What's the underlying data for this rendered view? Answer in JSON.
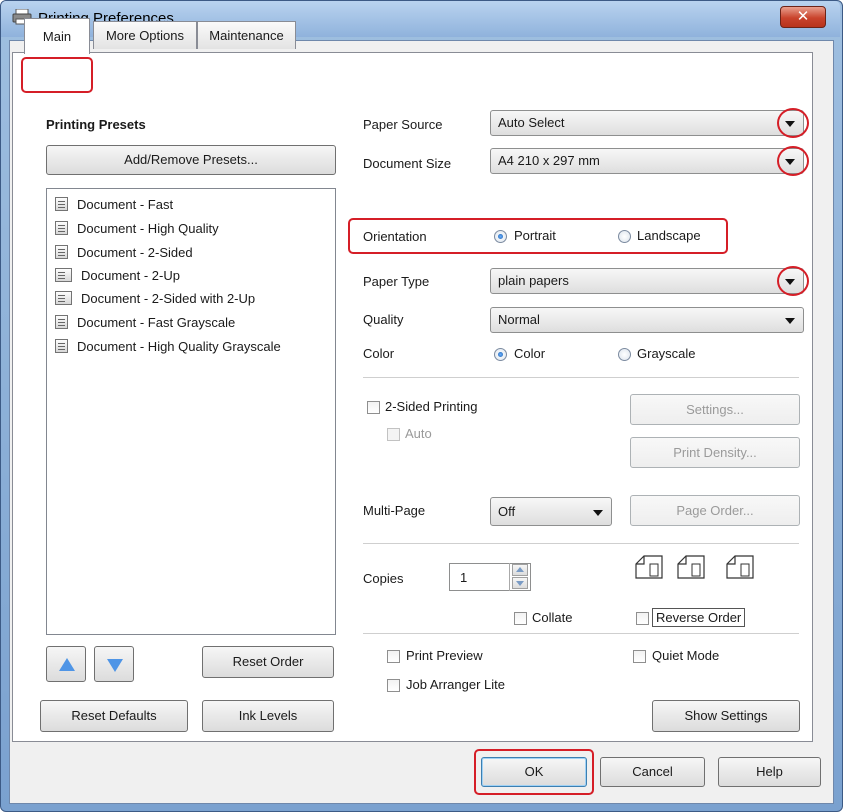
{
  "window": {
    "title": "Printing Preferences",
    "close_label": "✕"
  },
  "tabs": [
    {
      "label": "Main"
    },
    {
      "label": "More Options"
    },
    {
      "label": "Maintenance"
    }
  ],
  "presets": {
    "heading": "Printing Presets",
    "add_remove_label": "Add/Remove Presets...",
    "items": [
      "Document - Fast",
      "Document - High Quality",
      "Document - 2-Sided",
      "Document - 2-Up",
      "Document - 2-Sided with 2-Up",
      "Document - Fast Grayscale",
      "Document - High Quality Grayscale"
    ],
    "reset_order_label": "Reset Order",
    "reset_defaults_label": "Reset Defaults",
    "ink_levels_label": "Ink Levels"
  },
  "settings": {
    "paper_source": {
      "label": "Paper Source",
      "value": "Auto Select"
    },
    "document_size": {
      "label": "Document Size",
      "value": "A4 210 x 297 mm"
    },
    "orientation": {
      "label": "Orientation",
      "portrait": "Portrait",
      "landscape": "Landscape",
      "selected": "Portrait"
    },
    "paper_type": {
      "label": "Paper Type",
      "value": "plain papers"
    },
    "quality": {
      "label": "Quality",
      "value": "Normal"
    },
    "color": {
      "label": "Color",
      "color_option": "Color",
      "grayscale_option": "Grayscale",
      "selected": "Color"
    },
    "two_sided": {
      "label": "2-Sided Printing",
      "auto_label": "Auto",
      "settings_label": "Settings...",
      "print_density_label": "Print Density..."
    },
    "multi_page": {
      "label": "Multi-Page",
      "value": "Off",
      "page_order_label": "Page Order..."
    },
    "copies": {
      "label": "Copies",
      "value": "1",
      "collate_label": "Collate",
      "reverse_order_label": "Reverse Order"
    },
    "print_preview_label": "Print Preview",
    "quiet_mode_label": "Quiet Mode",
    "job_arranger_label": "Job Arranger Lite",
    "show_settings_label": "Show Settings"
  },
  "footer": {
    "ok_label": "OK",
    "cancel_label": "Cancel",
    "help_label": "Help"
  },
  "colors": {
    "highlight_red": "#d51e27",
    "accent_blue": "#4f95e6"
  }
}
